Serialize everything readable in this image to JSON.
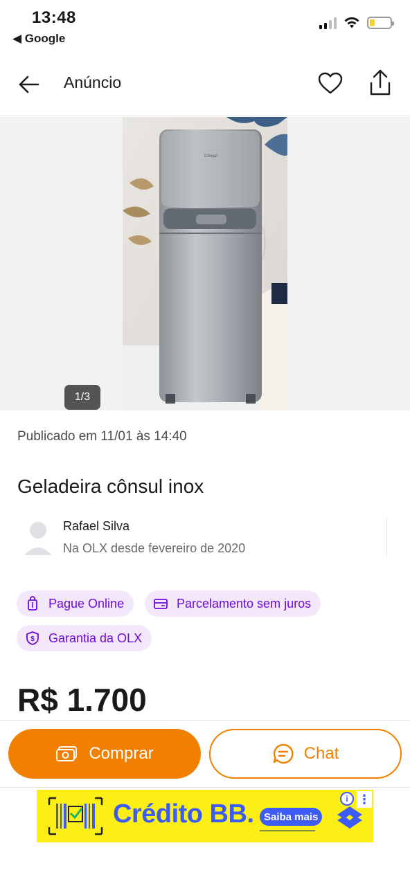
{
  "status_bar": {
    "time": "13:48",
    "back_app": "◀ Google"
  },
  "header": {
    "title": "Anúncio"
  },
  "gallery": {
    "counter": "1/3"
  },
  "listing": {
    "published": "Publicado em 11/01 às 14:40",
    "title": "Geladeira cônsul inox",
    "photo_brand": "Cônsul",
    "price": "R$ 1.700"
  },
  "seller": {
    "name": "Rafael Silva",
    "since": "Na OLX desde fevereiro de 2020"
  },
  "badges": [
    {
      "label": "Pague Online",
      "icon": "bag-icon"
    },
    {
      "label": "Parcelamento sem juros",
      "icon": "card-icon"
    },
    {
      "label": "Garantia da OLX",
      "icon": "shield-dollar-icon"
    }
  ],
  "actions": {
    "buy_label": "Comprar",
    "chat_label": "Chat"
  },
  "banner": {
    "brand": "Crédito BB.",
    "cta": "Saiba mais",
    "info": "i",
    "more": "⋮"
  },
  "colors": {
    "accent": "#f28000",
    "purple": "#6e0ad6",
    "badge_bg": "#f3e8fb",
    "banner_bg": "#fcef16",
    "banner_blue": "#3d5cf5"
  }
}
